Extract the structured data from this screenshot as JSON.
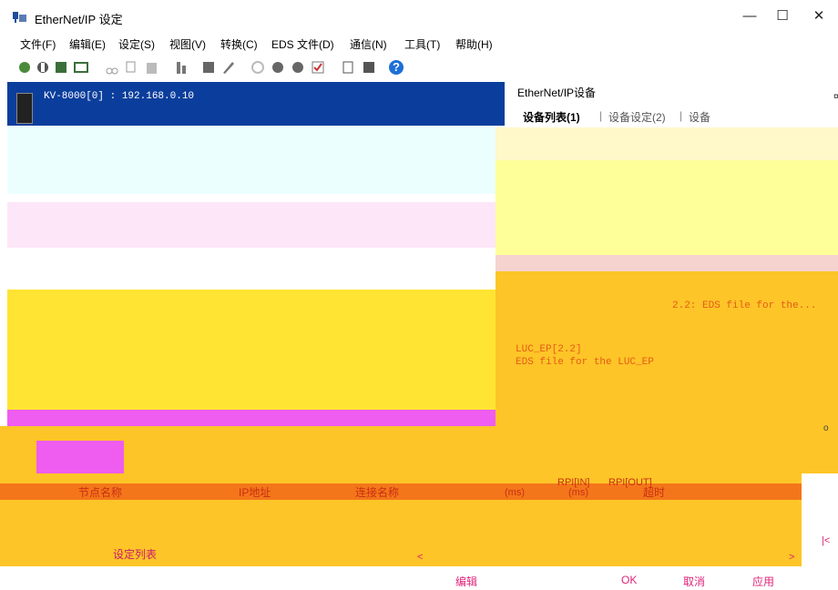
{
  "window": {
    "title": "EtherNet/IP 设定",
    "buttons": {
      "minimize": "—",
      "maximize": "☐",
      "close": "✕"
    }
  },
  "menu": [
    {
      "label": "文件(F)"
    },
    {
      "label": "编辑(E)"
    },
    {
      "label": "设定(S)"
    },
    {
      "label": "视图(V)"
    },
    {
      "label": "转换(C)"
    },
    {
      "label": "EDS 文件(D)"
    },
    {
      "label": "通信(N)"
    },
    {
      "label": "工具(T)"
    },
    {
      "label": "帮助(H)"
    }
  ],
  "toolbar": {
    "icons": [
      "connect-icon",
      "disconnect-icon",
      "device-search-icon",
      "monitor-icon",
      "cut-icon",
      "copy-icon",
      "paste-icon",
      "register-icon",
      "eds-icon",
      "edit-icon",
      "scan-icon",
      "upload-icon",
      "download-icon",
      "check-icon",
      "zoom-icon",
      "properties-icon",
      "help-icon"
    ],
    "help_glyph": "?"
  },
  "device_tree": {
    "root_label": "KV-8000[0] : 192.168.0.10"
  },
  "right_panel": {
    "title": "EtherNet/IP设备",
    "tabs": [
      {
        "label": "设备列表(1)"
      },
      {
        "label": "设备设定(2)"
      },
      {
        "label": "设备"
      }
    ],
    "pane_close": "¤",
    "devices": [
      {
        "label": "2.2: EDS file for the..."
      },
      {
        "label": "LUC_EP[2.2]"
      },
      {
        "label": "EDS file for the LUC_EP"
      }
    ]
  },
  "table": {
    "columns": [
      {
        "label": "节点名称"
      },
      {
        "label": "IP地址"
      },
      {
        "label": "连接名称"
      },
      {
        "label": "(ms)"
      },
      {
        "label": "(ms)"
      },
      {
        "label": "RPI[IN]"
      },
      {
        "label": "RPI[OUT]"
      },
      {
        "label": "超时"
      }
    ]
  },
  "bottom_tabs": [
    {
      "label": "设定列表"
    }
  ],
  "scroll": {
    "left": "<",
    "right": ">",
    "pane_prev": "|<",
    "pane_marker": "o"
  },
  "buttons": {
    "edit": "编辑",
    "ok": "OK",
    "cancel": "取消",
    "apply": "应用"
  },
  "colors": {
    "device_header": "#0b3e9c",
    "yellow_band": "#ffe433",
    "orange": "#f4761a",
    "cyan": "#ecffff",
    "pink": "#fde6f8",
    "magenta": "#ef5df0",
    "amber": "#fdc527"
  }
}
